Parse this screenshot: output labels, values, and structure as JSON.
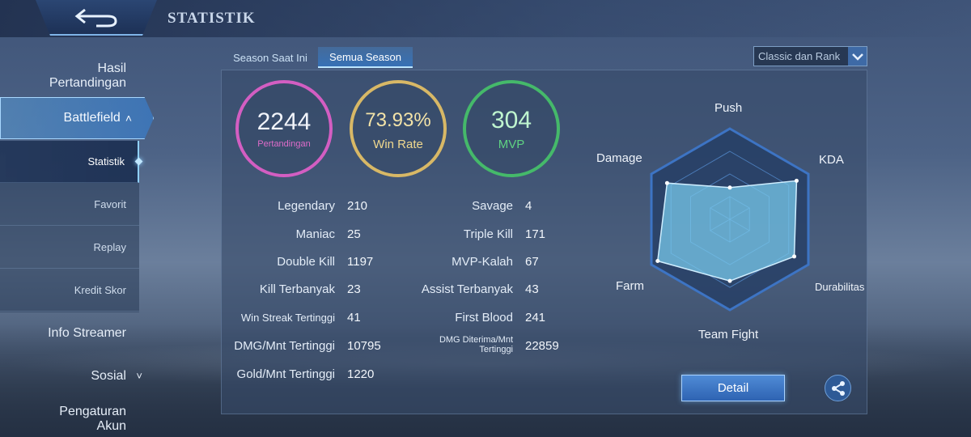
{
  "header": {
    "title": "STATISTIK"
  },
  "sidebar": {
    "items": [
      {
        "label": "Hasil\nPertandingan"
      },
      {
        "label": "Battlefield"
      },
      {
        "label": "Info Streamer"
      },
      {
        "label": "Sosial"
      },
      {
        "label": "Pengaturan\nAkun"
      }
    ],
    "sub_items": [
      {
        "label": "Statistik",
        "active": true
      },
      {
        "label": "Favorit"
      },
      {
        "label": "Replay"
      },
      {
        "label": "Kredit Skor"
      }
    ]
  },
  "tabs": [
    {
      "label": "Season Saat Ini",
      "active": false
    },
    {
      "label": "Semua Season",
      "active": true
    }
  ],
  "mode_select": {
    "value": "Classic dan Rank"
  },
  "summary": {
    "matches": {
      "value": "2244",
      "label": "Pertandingan",
      "color": "#d35ec2"
    },
    "win_rate": {
      "value": "73.93%",
      "label": "Win Rate",
      "color": "#d8b866"
    },
    "mvp": {
      "value": "304",
      "label": "MVP",
      "color": "#45b96a"
    }
  },
  "stats_left": [
    {
      "label": "Legendary",
      "value": "210"
    },
    {
      "label": "Maniac",
      "value": "25"
    },
    {
      "label": "Double Kill",
      "value": "1197"
    },
    {
      "label": "Kill Terbanyak",
      "value": "23"
    },
    {
      "label": "Win Streak Tertinggi",
      "value": "41"
    },
    {
      "label": "DMG/Mnt Tertinggi",
      "value": "10795"
    },
    {
      "label": "Gold/Mnt Tertinggi",
      "value": "1220"
    }
  ],
  "stats_right": [
    {
      "label": "Savage",
      "value": "4"
    },
    {
      "label": "Triple Kill",
      "value": "171"
    },
    {
      "label": "MVP-Kalah",
      "value": "67"
    },
    {
      "label": "Assist Terbanyak",
      "value": "43"
    },
    {
      "label": "First Blood",
      "value": "241"
    },
    {
      "label": "DMG Diterima/Mnt\nTertinggi",
      "value": "22859"
    }
  ],
  "radar": {
    "axes": [
      "Push",
      "KDA",
      "Durabilitas",
      "Team Fight",
      "Farm",
      "Damage"
    ],
    "values": [
      0.35,
      0.85,
      0.82,
      0.68,
      0.92,
      0.8
    ]
  },
  "actions": {
    "detail_label": "Detail",
    "share_icon": "share-icon"
  }
}
